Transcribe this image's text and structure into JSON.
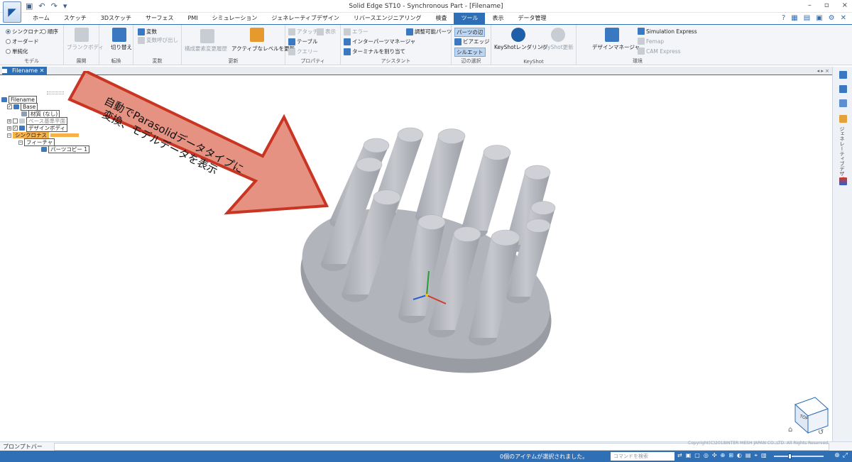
{
  "window": {
    "title": "Solid Edge ST10 - Synchronous Part - [Filename]",
    "controls": [
      "–",
      "▫",
      "×"
    ]
  },
  "tabs": [
    "ホーム",
    "スケッチ",
    "3Dスケッチ",
    "サーフェス",
    "PMI",
    "シミュレーション",
    "ジェネレーティブデザイン",
    "リバースエンジニアリング",
    "検査",
    "ツール",
    "表示",
    "データ管理"
  ],
  "active_tab": "ツール",
  "ribbon": {
    "model": {
      "options": [
        "シンクロナス",
        "順序",
        "オーダード",
        "単純化"
      ],
      "label": "モデル"
    },
    "expand": {
      "button": "ブランクボディ",
      "label": "展開"
    },
    "convert": {
      "button": "切り替え",
      "label": "転換"
    },
    "variables": {
      "items": [
        "変数",
        "変数呼び出し"
      ],
      "label": "変数"
    },
    "update": {
      "items": [
        "構成要素変更履歴",
        "アクティブなレベルを更新"
      ],
      "label": "更新"
    },
    "properties": {
      "items": [
        "アタッチ",
        "表示",
        "テーブル",
        "クエリー"
      ],
      "label": "プロパティ"
    },
    "assistant": {
      "items": [
        "エラー",
        "インターパーツマネージャ",
        "ターミナルを割り当て",
        "調整可能パーツ"
      ],
      "label": "アシスタント"
    },
    "edge_select": {
      "items": [
        "パーツの辺",
        "ビアエッジ",
        "シルエット"
      ],
      "label": "辺の選択"
    },
    "keyshot": {
      "items": [
        "KeyShotレンダリング",
        "KeyShot更新"
      ],
      "label": "KeyShot"
    },
    "environment": {
      "items": [
        "デザインマネージャ",
        "Simulation Express",
        "Femap",
        "CAM Express"
      ],
      "label": "環境"
    }
  },
  "document_tab": "Filename",
  "pathfinder": {
    "items": [
      "Filename",
      "Base",
      "材質 (なし)",
      "ベース基準平面",
      "デザインボディ",
      "シンクロナス",
      "フィーチャ",
      "パーツコピー 1"
    ]
  },
  "callout": {
    "lines": [
      "自動でParasolidデータタイプに",
      "変換、モデルデータを表示"
    ]
  },
  "right_panel": {
    "vertical_label": "ジェネレーティブデザイン"
  },
  "view_cube": {
    "face_label": "TOP"
  },
  "prompt_bar": {
    "label": "プロンプトバー"
  },
  "copyright": "Copyright(C)2018INTER MESH JAPAN CO.,LTD. All Rights Reserved.",
  "status": {
    "message": "0個のアイテムが選択されました。",
    "search_placeholder": "コマンドを検索"
  },
  "colors": {
    "accent": "#2f6fb5",
    "callout_fill": "#e48d7d",
    "callout_stroke": "#c72a18",
    "model": "#aeb1b9"
  }
}
